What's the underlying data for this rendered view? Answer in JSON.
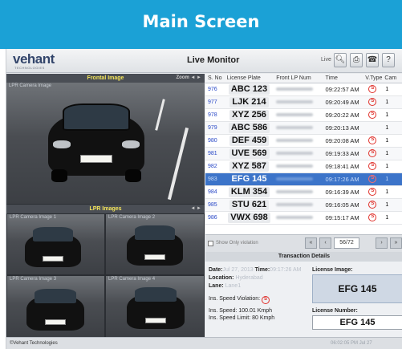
{
  "banner": {
    "title": "Main Screen"
  },
  "app": {
    "logo": "vehant",
    "logo_sub": "TECHNOLOGIES",
    "title": "Live Monitor",
    "live_label": "Live",
    "icons": [
      "search-icon",
      "print-icon",
      "phone-icon",
      "help-icon"
    ]
  },
  "frontal": {
    "title": "Frontal Image",
    "camera_label": "LPR Camera Image",
    "controls": "Zoom ◄ ►"
  },
  "lpr": {
    "title": "LPR Images",
    "controls": "◄ ►",
    "cams": [
      {
        "label": "LPR Camera Image 1"
      },
      {
        "label": "LPR Camera Image 2"
      },
      {
        "label": "LPR Camera Image 3"
      },
      {
        "label": "LPR Camera Image 4"
      }
    ]
  },
  "table": {
    "headers": [
      "S. No",
      "License Plate",
      "Front LP Num",
      "Time",
      "V.Type",
      "Cam"
    ],
    "rows": [
      {
        "sno": "976",
        "plate": "ABC 123",
        "time": "09:22:57 AM",
        "vtype": "S",
        "cam": "1"
      },
      {
        "sno": "977",
        "plate": "LJK 214",
        "time": "09:20:49 AM",
        "vtype": "S",
        "cam": "1"
      },
      {
        "sno": "978",
        "plate": "XYZ 256",
        "time": "09:20:22 AM",
        "vtype": "S",
        "cam": "1"
      },
      {
        "sno": "979",
        "plate": "ABC 586",
        "time": "09:20:13 AM",
        "vtype": "",
        "cam": "1"
      },
      {
        "sno": "980",
        "plate": "DEF 459",
        "time": "09:20:08 AM",
        "vtype": "S",
        "cam": "1"
      },
      {
        "sno": "981",
        "plate": "UVE 569",
        "time": "09:19:33 AM",
        "vtype": "S",
        "cam": "1"
      },
      {
        "sno": "982",
        "plate": "XYZ 587",
        "time": "09:18:41 AM",
        "vtype": "S",
        "cam": "1"
      },
      {
        "sno": "983",
        "plate": "EFG 145",
        "time": "09:17:26 AM",
        "vtype": "S",
        "cam": "1"
      },
      {
        "sno": "984",
        "plate": "KLM 354",
        "time": "09:16:39 AM",
        "vtype": "S",
        "cam": "1"
      },
      {
        "sno": "985",
        "plate": "STU 621",
        "time": "09:16:05 AM",
        "vtype": "S",
        "cam": "1"
      },
      {
        "sno": "986",
        "plate": "VWX 698",
        "time": "09:15:17 AM",
        "vtype": "S",
        "cam": "1"
      }
    ],
    "selected_index": 7
  },
  "pager": {
    "checkbox_label": "Show Only violation",
    "page": "56/72"
  },
  "transaction": {
    "title": "Transaction Details",
    "date_label": "Date:",
    "date_value": "Jul 27, 2013",
    "time_label": "Time:",
    "time_value": "09:17:26 AM",
    "location_label": "Location:",
    "location_value": "Hyderabad",
    "lane_label": "Lane:",
    "lane_value": "Lane1",
    "speed_violation_label": "Ins. Speed Violation:",
    "speed_label": "Ins. Speed: 100.01 Kmph",
    "limit_label": "Ins. Speed Limit: 80 Kmph",
    "license_image_label": "License Image:",
    "license_image_text": "EFG 145",
    "license_number_label": "License Number:",
    "license_number": "EFG 145"
  },
  "status": {
    "copyright": "©Vehant Technologies",
    "clock": "06:02:05 PM  Jul 27"
  },
  "colors": {
    "banner": "#1ba1d6",
    "selected_row": "#3c74c9",
    "violation": "#e0312b",
    "panel_title": "#f3e45a"
  }
}
